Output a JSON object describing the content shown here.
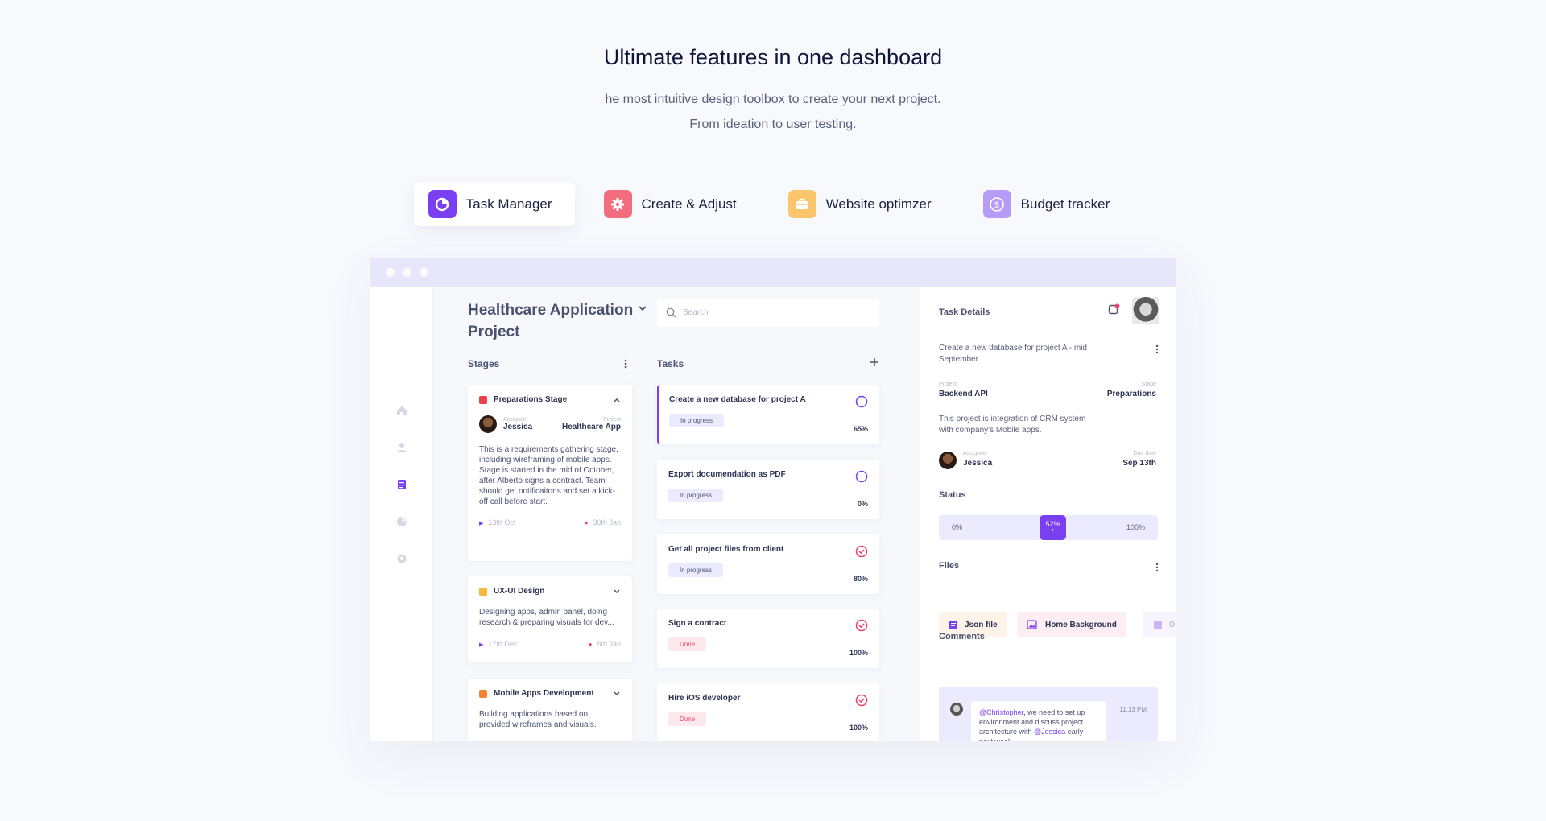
{
  "hero": {
    "title": "Ultimate features in one dashboard",
    "subtitle_line1": "he most intuitive design toolbox to create your next project.",
    "subtitle_line2": "From ideation to user testing."
  },
  "tabs": [
    {
      "label": "Task Manager",
      "icon": "pie-chart-icon",
      "color": "#7b3ff2",
      "active": true
    },
    {
      "label": "Create & Adjust",
      "icon": "gear-icon",
      "color": "#f26d7d"
    },
    {
      "label": "Website optimzer",
      "icon": "briefcase-icon",
      "color": "#fbc56b"
    },
    {
      "label": "Budget tracker",
      "icon": "dollar-icon",
      "color": "#b69cf6"
    }
  ],
  "project": {
    "title": "Healthcare Application Project",
    "search_placeholder": "Search"
  },
  "stages": {
    "header": "Stages",
    "items": [
      {
        "name": "Preparations Stage",
        "color": "#ef3f4f",
        "assignee_label": "Assignee",
        "assignee": "Jessica",
        "project_label": "Project",
        "project": "Healthcare App",
        "description": "This is a requirements gathering stage, including wireframing of mobile apps. Stage is started in the mid of October, after Alberto signs a contract. Team should get notificaitons and set a kick-off call before start.",
        "start": "13th Oct",
        "end": "30th Jan"
      },
      {
        "name": "UX-UI Design",
        "color": "#f6b73c",
        "description": "Designing apps, admin panel, doing research & preparing visuals for dev...",
        "start": "17th Dec",
        "end": "5th Jan"
      },
      {
        "name": "Mobile Apps Development",
        "color": "#f4842f",
        "description": "Building applications based on provided wireframes and visuals."
      }
    ]
  },
  "tasks": {
    "header": "Tasks",
    "items": [
      {
        "title": "Create a new database for project A",
        "status": "In progress",
        "percent": "65%",
        "state": "open"
      },
      {
        "title": "Export documendation as PDF",
        "status": "In progress",
        "percent": "0%",
        "state": "open"
      },
      {
        "title": "Get all project files from client",
        "status": "In progress",
        "percent": "80%",
        "state": "checked"
      },
      {
        "title": "Sign a contract",
        "status": "Done",
        "percent": "100%",
        "state": "checked"
      },
      {
        "title": "Hire iOS developer",
        "status": "Done",
        "percent": "100%",
        "state": "checked"
      }
    ]
  },
  "details": {
    "header": "Task Details",
    "task_title": "Create a new database for project A - mid September",
    "project_label": "Project",
    "project": "Backend API",
    "stage_label": "Stage",
    "stage": "Preparations",
    "description": "This project is integration of CRM system with  company's Mobile apps.",
    "assignee_label": "Assignee",
    "assignee": "Jessica",
    "due_label": "Due date",
    "due": "Sep 13th",
    "status_header": "Status",
    "status_min": "0%",
    "status_max": "100%",
    "status_value": "52%",
    "status_fraction": 0.52,
    "files_header": "Files",
    "files": [
      "Json file",
      "Home Background",
      "D"
    ],
    "comments_header": "Comments",
    "comment": {
      "mention1": "@Christopher",
      "text1": ", we need to set up environment and discuss project architecture with ",
      "mention2": "@Jessica",
      "text2": " early next week.",
      "time": "11:13 PM"
    }
  }
}
